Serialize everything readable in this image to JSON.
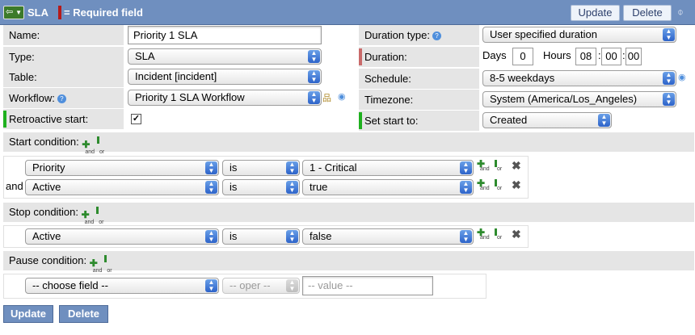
{
  "header": {
    "title": "SLA",
    "required_legend": "= Required field",
    "update_label": "Update",
    "delete_label": "Delete"
  },
  "form": {
    "name": {
      "label": "Name:",
      "value": "Priority 1 SLA"
    },
    "type": {
      "label": "Type:",
      "value": "SLA"
    },
    "table": {
      "label": "Table:",
      "value": "Incident [incident]"
    },
    "workflow": {
      "label": "Workflow:",
      "value": "Priority 1 SLA Workflow"
    },
    "retroactive_start": {
      "label": "Retroactive start:",
      "checked": true
    },
    "duration_type": {
      "label": "Duration type:",
      "value": "User specified duration"
    },
    "duration": {
      "label": "Duration:",
      "days_label": "Days",
      "days": "0",
      "hours_label": "Hours",
      "hh": "08",
      "mm": "00",
      "ss": "00"
    },
    "schedule": {
      "label": "Schedule:",
      "value": "8-5 weekdays"
    },
    "timezone": {
      "label": "Timezone:",
      "value": "System (America/Los_Angeles)"
    },
    "set_start_to": {
      "label": "Set start to:",
      "value": "Created"
    }
  },
  "icons": {
    "and": "and",
    "or": "or"
  },
  "start_condition": {
    "label": "Start condition:",
    "rows": [
      {
        "conj": "",
        "field": "Priority",
        "oper": "is",
        "value": "1 - Critical"
      },
      {
        "conj": "and",
        "field": "Active",
        "oper": "is",
        "value": "true"
      }
    ]
  },
  "stop_condition": {
    "label": "Stop condition:",
    "rows": [
      {
        "conj": "",
        "field": "Active",
        "oper": "is",
        "value": "false"
      }
    ]
  },
  "pause_condition": {
    "label": "Pause condition:",
    "field_placeholder": "-- choose field --",
    "oper_placeholder": "-- oper --",
    "value_placeholder": "-- value --"
  },
  "footer": {
    "update_label": "Update",
    "delete_label": "Delete"
  }
}
